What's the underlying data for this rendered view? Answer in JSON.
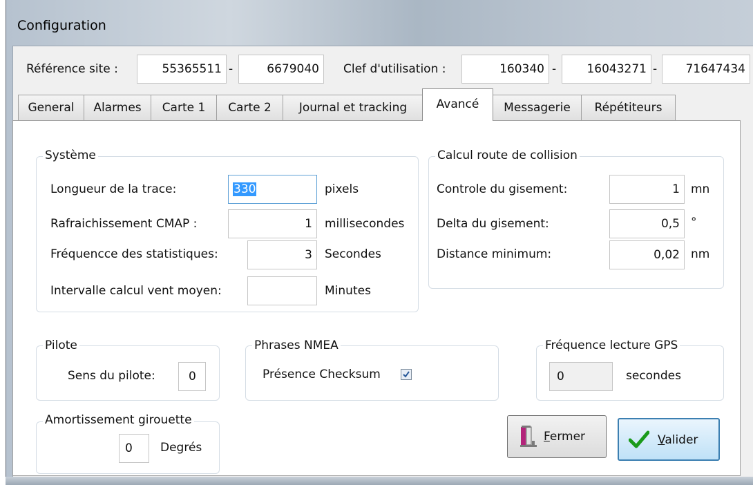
{
  "window": {
    "title": "Configuration"
  },
  "header": {
    "site_ref_label": "Référence site :",
    "site_ref_1": "55365511",
    "sep1": "-",
    "site_ref_2": "6679040",
    "key_label": "Clef d'utilisation :",
    "key_1": "160340",
    "sep2": "-",
    "key_2": "16043271",
    "sep3": "-",
    "key_3": "71647434"
  },
  "tabs": [
    {
      "label": "General"
    },
    {
      "label": "Alarmes"
    },
    {
      "label": "Carte 1"
    },
    {
      "label": "Carte 2"
    },
    {
      "label": "Journal et tracking"
    },
    {
      "label": "Avancé",
      "active": true
    },
    {
      "label": "Messagerie"
    },
    {
      "label": "Répétiteurs"
    }
  ],
  "systeme": {
    "title": "Système",
    "rows": [
      {
        "label": "Longueur de la trace:",
        "value": "330",
        "unit": "pixels"
      },
      {
        "label": "Rafraichissement CMAP :",
        "value": "1",
        "unit": "millisecondes"
      },
      {
        "label": "Fréquencce des statistiques:",
        "value": "3",
        "unit": "Secondes"
      },
      {
        "label": "Intervalle calcul vent moyen:",
        "value": "",
        "unit": "Minutes"
      }
    ]
  },
  "collision": {
    "title": "Calcul route de collision",
    "rows": [
      {
        "label": "Controle du gisement:",
        "value": "1",
        "unit": "mn"
      },
      {
        "label": "Delta du gisement:",
        "value": "0,5",
        "unit": "°"
      },
      {
        "label": "Distance minimum:",
        "value": "0,02",
        "unit": "nm"
      }
    ]
  },
  "pilote": {
    "title": "Pilote",
    "label": "Sens du pilote:",
    "value": "0"
  },
  "nmea": {
    "title": "Phrases NMEA",
    "label": "Présence Checksum",
    "checked": true
  },
  "gps": {
    "title": "Fréquence lecture GPS",
    "value": "0",
    "unit": "secondes"
  },
  "girouette": {
    "title": "Amortissement girouette",
    "value": "0",
    "unit": "Degrés"
  },
  "buttons": {
    "close": {
      "label": "Fermer",
      "mnemonic": "F",
      "rest": "ermer",
      "icon": "exit-door-icon"
    },
    "ok": {
      "label": "Valider",
      "mnemonic": "V",
      "rest": "alider",
      "icon": "checkmark-icon"
    }
  },
  "colors": {
    "selection": "#3399ff",
    "checkmark": "#1a9a1a",
    "primary_border": "#3c7fb1"
  }
}
